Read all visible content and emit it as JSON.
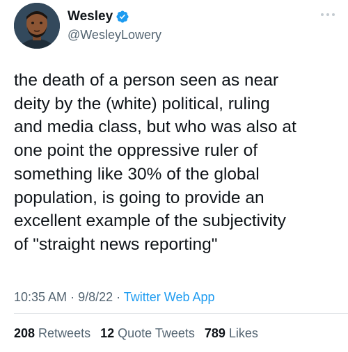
{
  "author": {
    "display_name": "Wesley",
    "handle": "@WesleyLowery",
    "verified": true,
    "avatar_icon": "avatar-portrait"
  },
  "tweet": {
    "text": "the death of a person seen as near\ndeity by the (white) political, ruling\nand media class, but who was also at\none point the oppressive ruler of\nsomething like 30% of the global\npopulation, is going to provide an\nexcellent example of the subjectivity\nof \"straight news reporting\"",
    "time": "10:35 AM",
    "separator": " · ",
    "date": "9/8/22",
    "source": "Twitter Web App"
  },
  "stats": {
    "retweets_count": "208",
    "retweets_label": "Retweets",
    "quote_tweets_count": "12",
    "quote_tweets_label": "Quote Tweets",
    "likes_count": "789",
    "likes_label": "Likes"
  },
  "colors": {
    "accent": "#1d9bf0",
    "text_primary": "#0f1419",
    "text_secondary": "#536471"
  },
  "icons": {
    "verified": "verified-badge-icon",
    "more": "more-options-icon"
  }
}
